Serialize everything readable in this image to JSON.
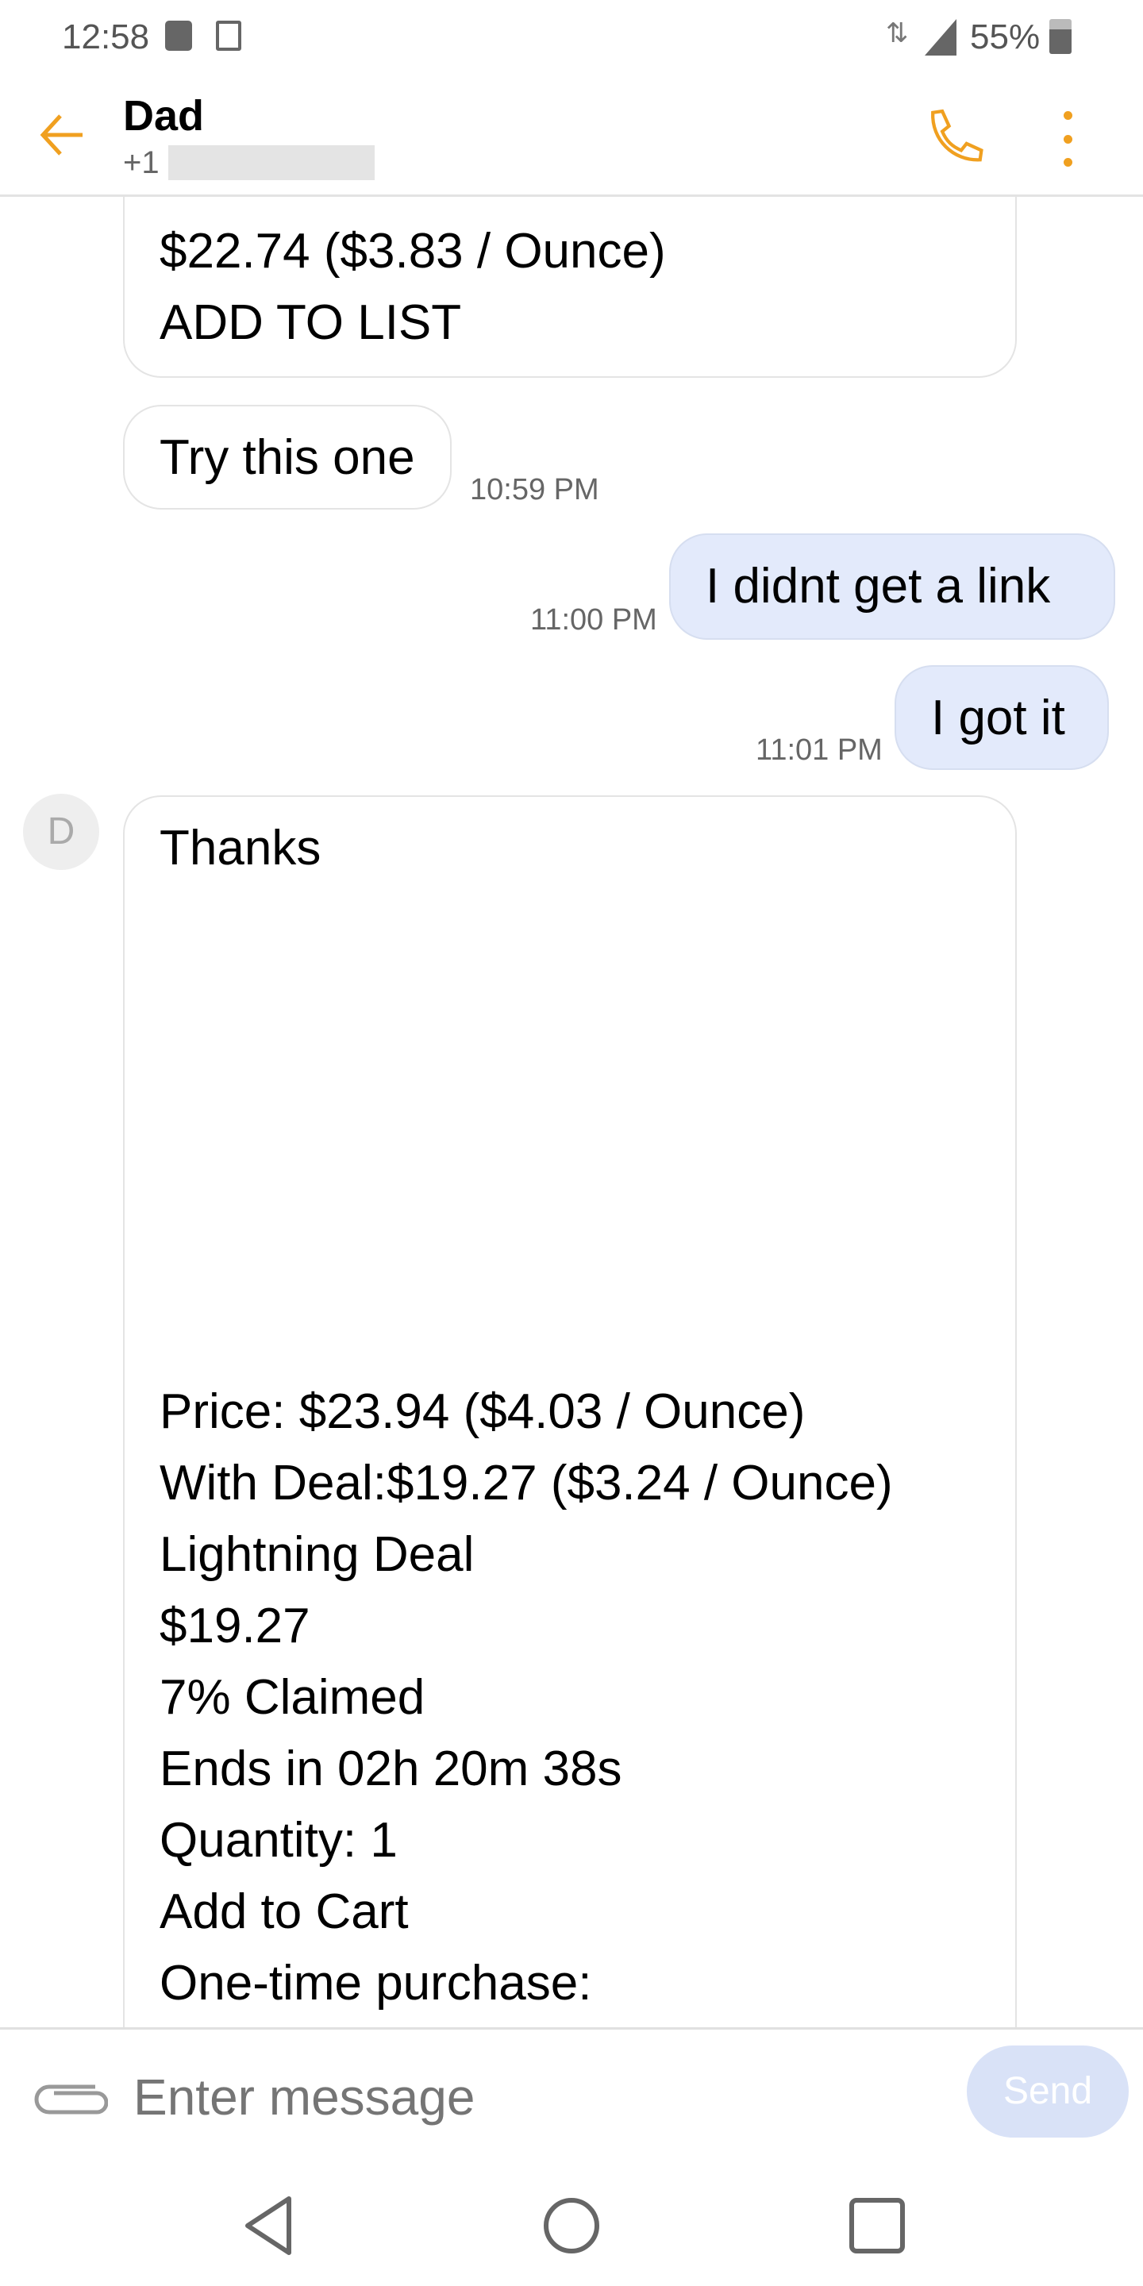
{
  "status_bar": {
    "time": "12:58",
    "battery": "55%",
    "icons": [
      "alarm-message-icon",
      "gallery-icon",
      "wifi-icon",
      "signal-icon",
      "battery-icon"
    ]
  },
  "header": {
    "contact_name": "Dad",
    "phone_prefix": "+1",
    "accent": "#f0a020"
  },
  "messages": [
    {
      "direction": "received",
      "lines": [
        "$22.74 ($3.83 / Ounce)",
        "ADD TO LIST"
      ]
    },
    {
      "direction": "received",
      "text": "Try this one",
      "time": "10:59 PM"
    },
    {
      "direction": "sent",
      "text": "I didnt get a link",
      "time": "11:00 PM"
    },
    {
      "direction": "sent",
      "text": "I got it",
      "time": "11:01 PM"
    },
    {
      "direction": "received",
      "avatar": "D",
      "first": "Thanks",
      "lines": [
        "Price: $23.94 ($4.03 / Ounce)",
        "With Deal:$19.27 ($3.24 / Ounce)",
        "Lightning Deal",
        "$19.27",
        "7% Claimed",
        "Ends in 02h 20m 38s",
        "Quantity: 1",
        "Add to Cart",
        "One-time purchase:"
      ]
    }
  ],
  "composer": {
    "placeholder": "Enter message",
    "send_label": "Send"
  },
  "colors": {
    "sent_bubble": "#e3eafb",
    "accent": "#f0a020"
  }
}
